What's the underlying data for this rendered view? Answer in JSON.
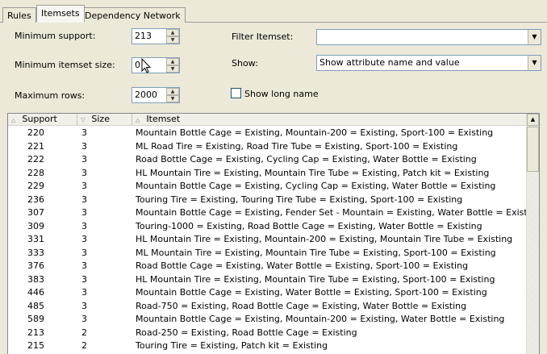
{
  "tabs": [
    {
      "label": "Rules",
      "active": false
    },
    {
      "label": "Itemsets",
      "active": true
    },
    {
      "label": "Dependency Network",
      "active": false
    }
  ],
  "form": {
    "min_support_label": "Minimum support:",
    "min_support_value": "213",
    "min_itemset_size_label": "Minimum itemset size:",
    "min_itemset_size_value": "0",
    "max_rows_label": "Maximum rows:",
    "max_rows_value": "2000",
    "filter_itemset_label": "Filter Itemset:",
    "filter_itemset_value": "",
    "show_label": "Show:",
    "show_value": "Show attribute name and value",
    "show_long_name_label": "Show long name",
    "show_long_name_checked": false
  },
  "grid": {
    "columns": [
      "Support",
      "Size",
      "Itemset"
    ],
    "rows": [
      {
        "support": "220",
        "size": "3",
        "itemset": "Mountain Bottle Cage = Existing, Mountain-200 = Existing, Sport-100 = Existing"
      },
      {
        "support": "221",
        "size": "3",
        "itemset": "ML Road Tire = Existing, Road Tire Tube = Existing, Sport-100 = Existing"
      },
      {
        "support": "222",
        "size": "3",
        "itemset": "Road Bottle Cage = Existing, Cycling Cap = Existing, Water Bottle = Existing"
      },
      {
        "support": "228",
        "size": "3",
        "itemset": "HL Mountain Tire = Existing, Mountain Tire Tube = Existing, Patch kit = Existing"
      },
      {
        "support": "229",
        "size": "3",
        "itemset": "Mountain Bottle Cage = Existing, Cycling Cap = Existing, Water Bottle = Existing"
      },
      {
        "support": "236",
        "size": "3",
        "itemset": "Touring Tire = Existing, Touring Tire Tube = Existing, Sport-100 = Existing"
      },
      {
        "support": "307",
        "size": "3",
        "itemset": "Mountain Bottle Cage = Existing, Fender Set - Mountain = Existing, Water Bottle = Existing"
      },
      {
        "support": "309",
        "size": "3",
        "itemset": "Touring-1000 = Existing, Road Bottle Cage = Existing, Water Bottle = Existing"
      },
      {
        "support": "331",
        "size": "3",
        "itemset": "HL Mountain Tire = Existing, Mountain-200 = Existing, Mountain Tire Tube = Existing"
      },
      {
        "support": "333",
        "size": "3",
        "itemset": "ML Mountain Tire = Existing, Mountain Tire Tube = Existing, Sport-100 = Existing"
      },
      {
        "support": "376",
        "size": "3",
        "itemset": "Road Bottle Cage = Existing, Water Bottle = Existing, Sport-100 = Existing"
      },
      {
        "support": "383",
        "size": "3",
        "itemset": "HL Mountain Tire = Existing, Mountain Tire Tube = Existing, Sport-100 = Existing"
      },
      {
        "support": "446",
        "size": "3",
        "itemset": "Mountain Bottle Cage = Existing, Water Bottle = Existing, Sport-100 = Existing"
      },
      {
        "support": "485",
        "size": "3",
        "itemset": "Road-750 = Existing, Road Bottle Cage = Existing, Water Bottle = Existing"
      },
      {
        "support": "589",
        "size": "3",
        "itemset": "Mountain Bottle Cage = Existing, Mountain-200 = Existing, Water Bottle = Existing"
      },
      {
        "support": "213",
        "size": "2",
        "itemset": "Road-250 = Existing, Road Bottle Cage = Existing"
      },
      {
        "support": "215",
        "size": "2",
        "itemset": "Touring Tire = Existing, Patch kit = Existing"
      }
    ]
  },
  "icons": {
    "spin_up": "spin-up-arrow-icon",
    "spin_down": "spin-down-arrow-icon",
    "dropdown": "chevron-down-icon",
    "sort": "sort-indicator-icon",
    "scroll_up": "scroll-up-arrow-icon"
  }
}
